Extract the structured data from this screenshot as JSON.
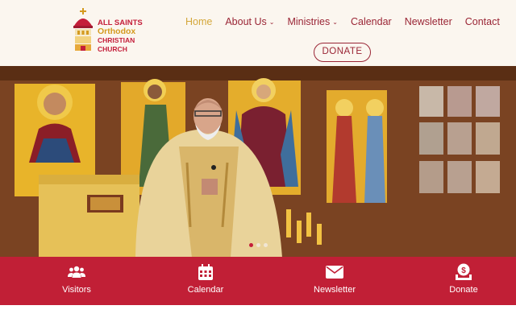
{
  "logo": {
    "line1": "ALL SAINTS",
    "line2": "Orthodox",
    "line3": "CHRISTIAN",
    "line4": "CHURCH"
  },
  "nav": [
    {
      "label": "Home",
      "active": true,
      "dropdown": false
    },
    {
      "label": "About Us",
      "active": false,
      "dropdown": true
    },
    {
      "label": "Ministries",
      "active": false,
      "dropdown": true
    },
    {
      "label": "Calendar",
      "active": false,
      "dropdown": false
    },
    {
      "label": "Newsletter",
      "active": false,
      "dropdown": false
    },
    {
      "label": "Contact",
      "active": false,
      "dropdown": false
    }
  ],
  "donate_button": "DONATE",
  "carousel": {
    "count": 3,
    "current": 1
  },
  "quick_links": [
    {
      "label": "Visitors",
      "icon": "users-icon"
    },
    {
      "label": "Calendar",
      "icon": "calendar-icon"
    },
    {
      "label": "Newsletter",
      "icon": "envelope-icon"
    },
    {
      "label": "Donate",
      "icon": "donate-icon"
    }
  ],
  "colors": {
    "header_bg": "#fbf6ef",
    "brand_red": "#c11f36",
    "nav_text": "#9a2535",
    "nav_active": "#d4a73a"
  }
}
